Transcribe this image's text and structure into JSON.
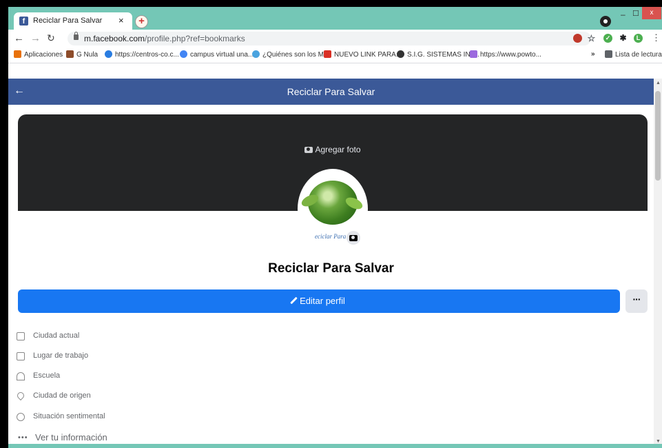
{
  "browser": {
    "tab_title": "Reciclar Para Salvar",
    "tab_close": "×",
    "new_tab": "+",
    "url_host": "m.facebook.com",
    "url_rest": "/profile.php?ref=bookmarks",
    "window": {
      "minimize": "–",
      "maximize": "☐",
      "close": "x"
    },
    "extensions": [
      {
        "icon": "key-icon",
        "label": "",
        "color": "#c0392b"
      },
      {
        "icon": "star-icon",
        "label": "☆",
        "color": "#5f6368"
      },
      {
        "icon": "check-icon",
        "label": "✓",
        "color": "#4caf50"
      },
      {
        "icon": "puzzle-icon",
        "label": "✱",
        "color": "#202124"
      },
      {
        "icon": "profile-icon",
        "label": "L",
        "color": "#4caf50"
      }
    ]
  },
  "bookmarks": {
    "items": [
      {
        "label": "Aplicaciones",
        "icon": "apps-icon",
        "color": "#e8710a"
      },
      {
        "label": "G Nula",
        "icon": "image-icon",
        "color": "#8d4c2a"
      },
      {
        "label": "https://centros-co.c...",
        "icon": "globe-icon",
        "color": "#2a7de1"
      },
      {
        "label": "campus virtual una...",
        "icon": "google-icon",
        "color": "#4285f4"
      },
      {
        "label": "¿Quiénes son los M...",
        "icon": "site-icon",
        "color": "#4aa3df"
      },
      {
        "label": "NUEVO LINK PARA...",
        "icon": "gmail-icon",
        "color": "#d93025"
      },
      {
        "label": "S.I.G. SISTEMAS INF...",
        "icon": "site-icon",
        "color": "#333333"
      },
      {
        "label": "https://www.powto...",
        "icon": "site-icon",
        "color": "#9c6ade"
      }
    ],
    "overflow": "»",
    "reading_list": "Lista de lectura"
  },
  "fb": {
    "header_title": "Reciclar Para Salvar",
    "back": "←",
    "add_photo": "Agregar foto",
    "avatar_caption": "eciclar Para S",
    "profile_name": "Reciclar Para Salvar",
    "edit_profile": "Editar perfil",
    "more": "···",
    "info": [
      {
        "label": "Ciudad actual",
        "icon": "home-icon"
      },
      {
        "label": "Lugar de trabajo",
        "icon": "briefcase-icon"
      },
      {
        "label": "Escuela",
        "icon": "graduation-cap-icon"
      },
      {
        "label": "Ciudad de origen",
        "icon": "location-pin-icon"
      },
      {
        "label": "Situación sentimental",
        "icon": "heart-icon"
      }
    ],
    "see_info": "Ver tu información",
    "see_info_dots": "•••"
  }
}
